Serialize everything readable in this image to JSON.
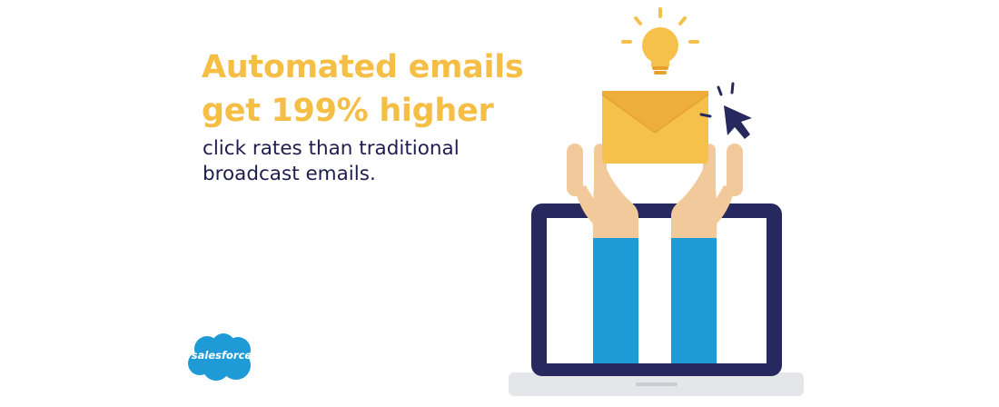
{
  "headline": {
    "line1": "Automated emails",
    "line2": "get 199% higher"
  },
  "subtext": {
    "line1": "click rates than traditional",
    "line2": "broadcast emails."
  },
  "logo": {
    "text": "salesforce",
    "icon": "salesforce-cloud-logo"
  },
  "illustration": {
    "icons": [
      "lightbulb-icon",
      "envelope-icon",
      "cursor-arrow-icon",
      "laptop-icon",
      "hands-icon"
    ]
  },
  "colors": {
    "headline": "#F5BE45",
    "subtext": "#1F1D4E",
    "laptop_frame": "#26285E",
    "laptop_base": "#E4E6EA",
    "sleeve": "#1E9BD7",
    "skin": "#F2C99B",
    "envelope": "#F6C14B",
    "envelope_flap": "#EEAE3A",
    "bulb": "#F6C14B",
    "cursor": "#26285E",
    "logo_cloud": "#1E9BD7"
  }
}
